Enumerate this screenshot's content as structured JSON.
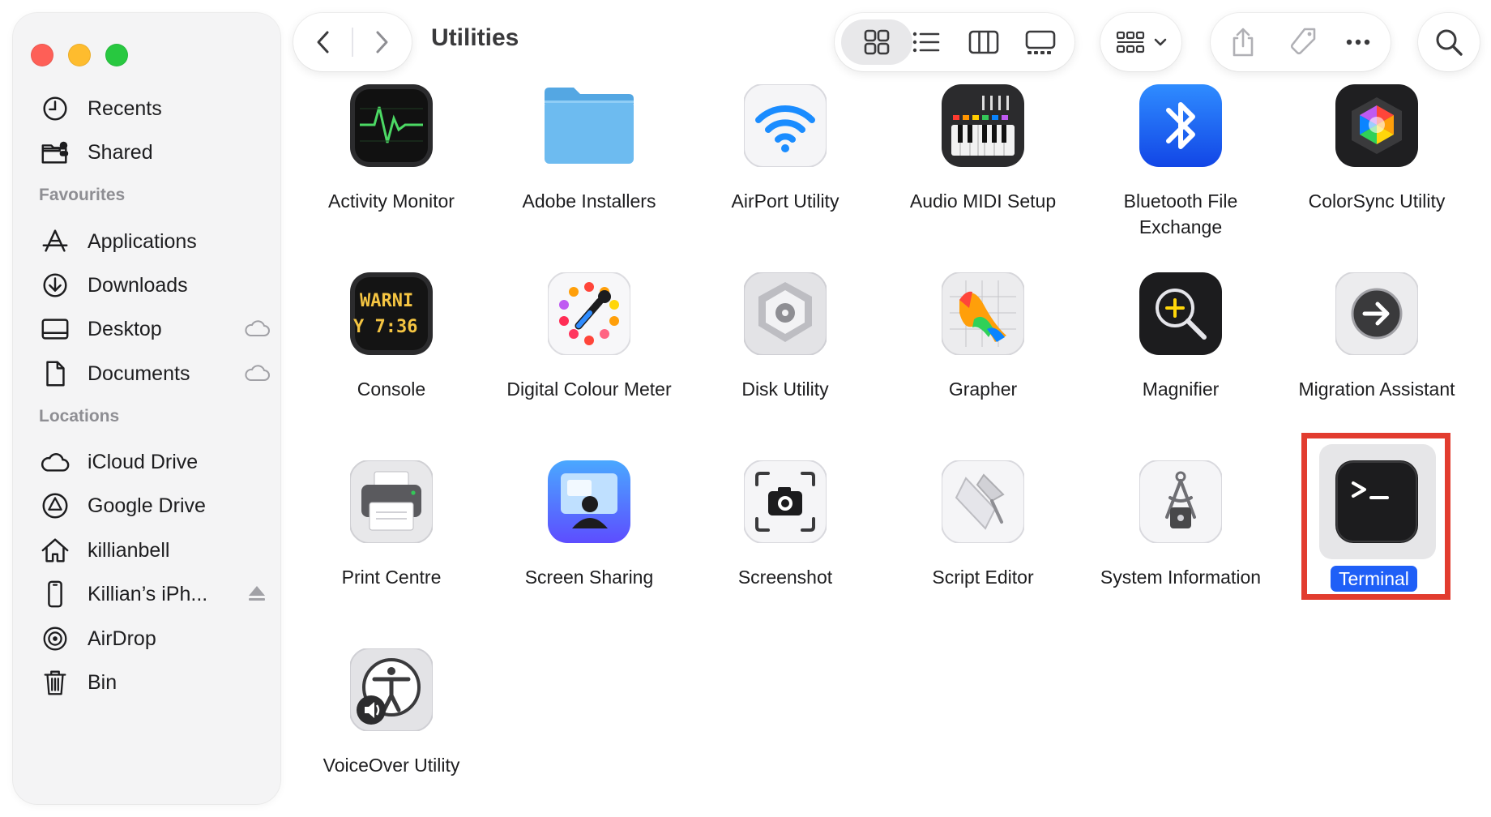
{
  "window": {
    "title": "Utilities"
  },
  "sidebar": {
    "items_top": [
      {
        "label": "Recents",
        "icon": "clock-icon"
      },
      {
        "label": "Shared",
        "icon": "shared-folder-icon"
      }
    ],
    "favourites_header": "Favourites",
    "favourites": [
      {
        "label": "Applications",
        "icon": "applications-icon"
      },
      {
        "label": "Downloads",
        "icon": "download-icon"
      },
      {
        "label": "Desktop",
        "icon": "desktop-icon",
        "trailing": "icloud-icon"
      },
      {
        "label": "Documents",
        "icon": "document-icon",
        "trailing": "icloud-icon"
      }
    ],
    "locations_header": "Locations",
    "locations": [
      {
        "label": "iCloud Drive",
        "icon": "cloud-icon"
      },
      {
        "label": "Google Drive",
        "icon": "google-drive-icon"
      },
      {
        "label": "killianbell",
        "icon": "home-icon"
      },
      {
        "label": "Killian’s iPh...",
        "icon": "iphone-icon",
        "trailing": "eject-icon"
      },
      {
        "label": "AirDrop",
        "icon": "airdrop-icon"
      },
      {
        "label": "Bin",
        "icon": "trash-icon"
      }
    ]
  },
  "toolbar": {
    "view_mode_selected": "icons"
  },
  "apps": [
    {
      "name": "Activity Monitor",
      "icon": "activity-monitor-icon"
    },
    {
      "name": "Adobe Installers",
      "icon": "folder-icon"
    },
    {
      "name": "AirPort Utility",
      "icon": "wifi-icon"
    },
    {
      "name": "Audio MIDI Setup",
      "icon": "midi-keyboard-icon"
    },
    {
      "name": "Bluetooth File Exchange",
      "icon": "bluetooth-icon"
    },
    {
      "name": "ColorSync Utility",
      "icon": "colorsync-icon"
    },
    {
      "name": "Console",
      "icon": "console-icon",
      "screen_text": [
        "WARNI",
        "Y 7:36"
      ]
    },
    {
      "name": "Digital Colour Meter",
      "icon": "color-meter-icon"
    },
    {
      "name": "Disk Utility",
      "icon": "disk-utility-icon"
    },
    {
      "name": "Grapher",
      "icon": "grapher-icon"
    },
    {
      "name": "Magnifier",
      "icon": "magnifier-icon"
    },
    {
      "name": "Migration Assistant",
      "icon": "migration-assistant-icon"
    },
    {
      "name": "Print Centre",
      "icon": "printer-icon"
    },
    {
      "name": "Screen Sharing",
      "icon": "screen-sharing-icon"
    },
    {
      "name": "Screenshot",
      "icon": "screenshot-icon"
    },
    {
      "name": "Script Editor",
      "icon": "script-editor-icon"
    },
    {
      "name": "System Information",
      "icon": "system-information-icon"
    },
    {
      "name": "Terminal",
      "icon": "terminal-icon",
      "selected": true
    },
    {
      "name": "VoiceOver Utility",
      "icon": "voiceover-icon"
    }
  ],
  "colors": {
    "selection": "#1f5ff7",
    "highlight_box": "#e23c2f"
  }
}
